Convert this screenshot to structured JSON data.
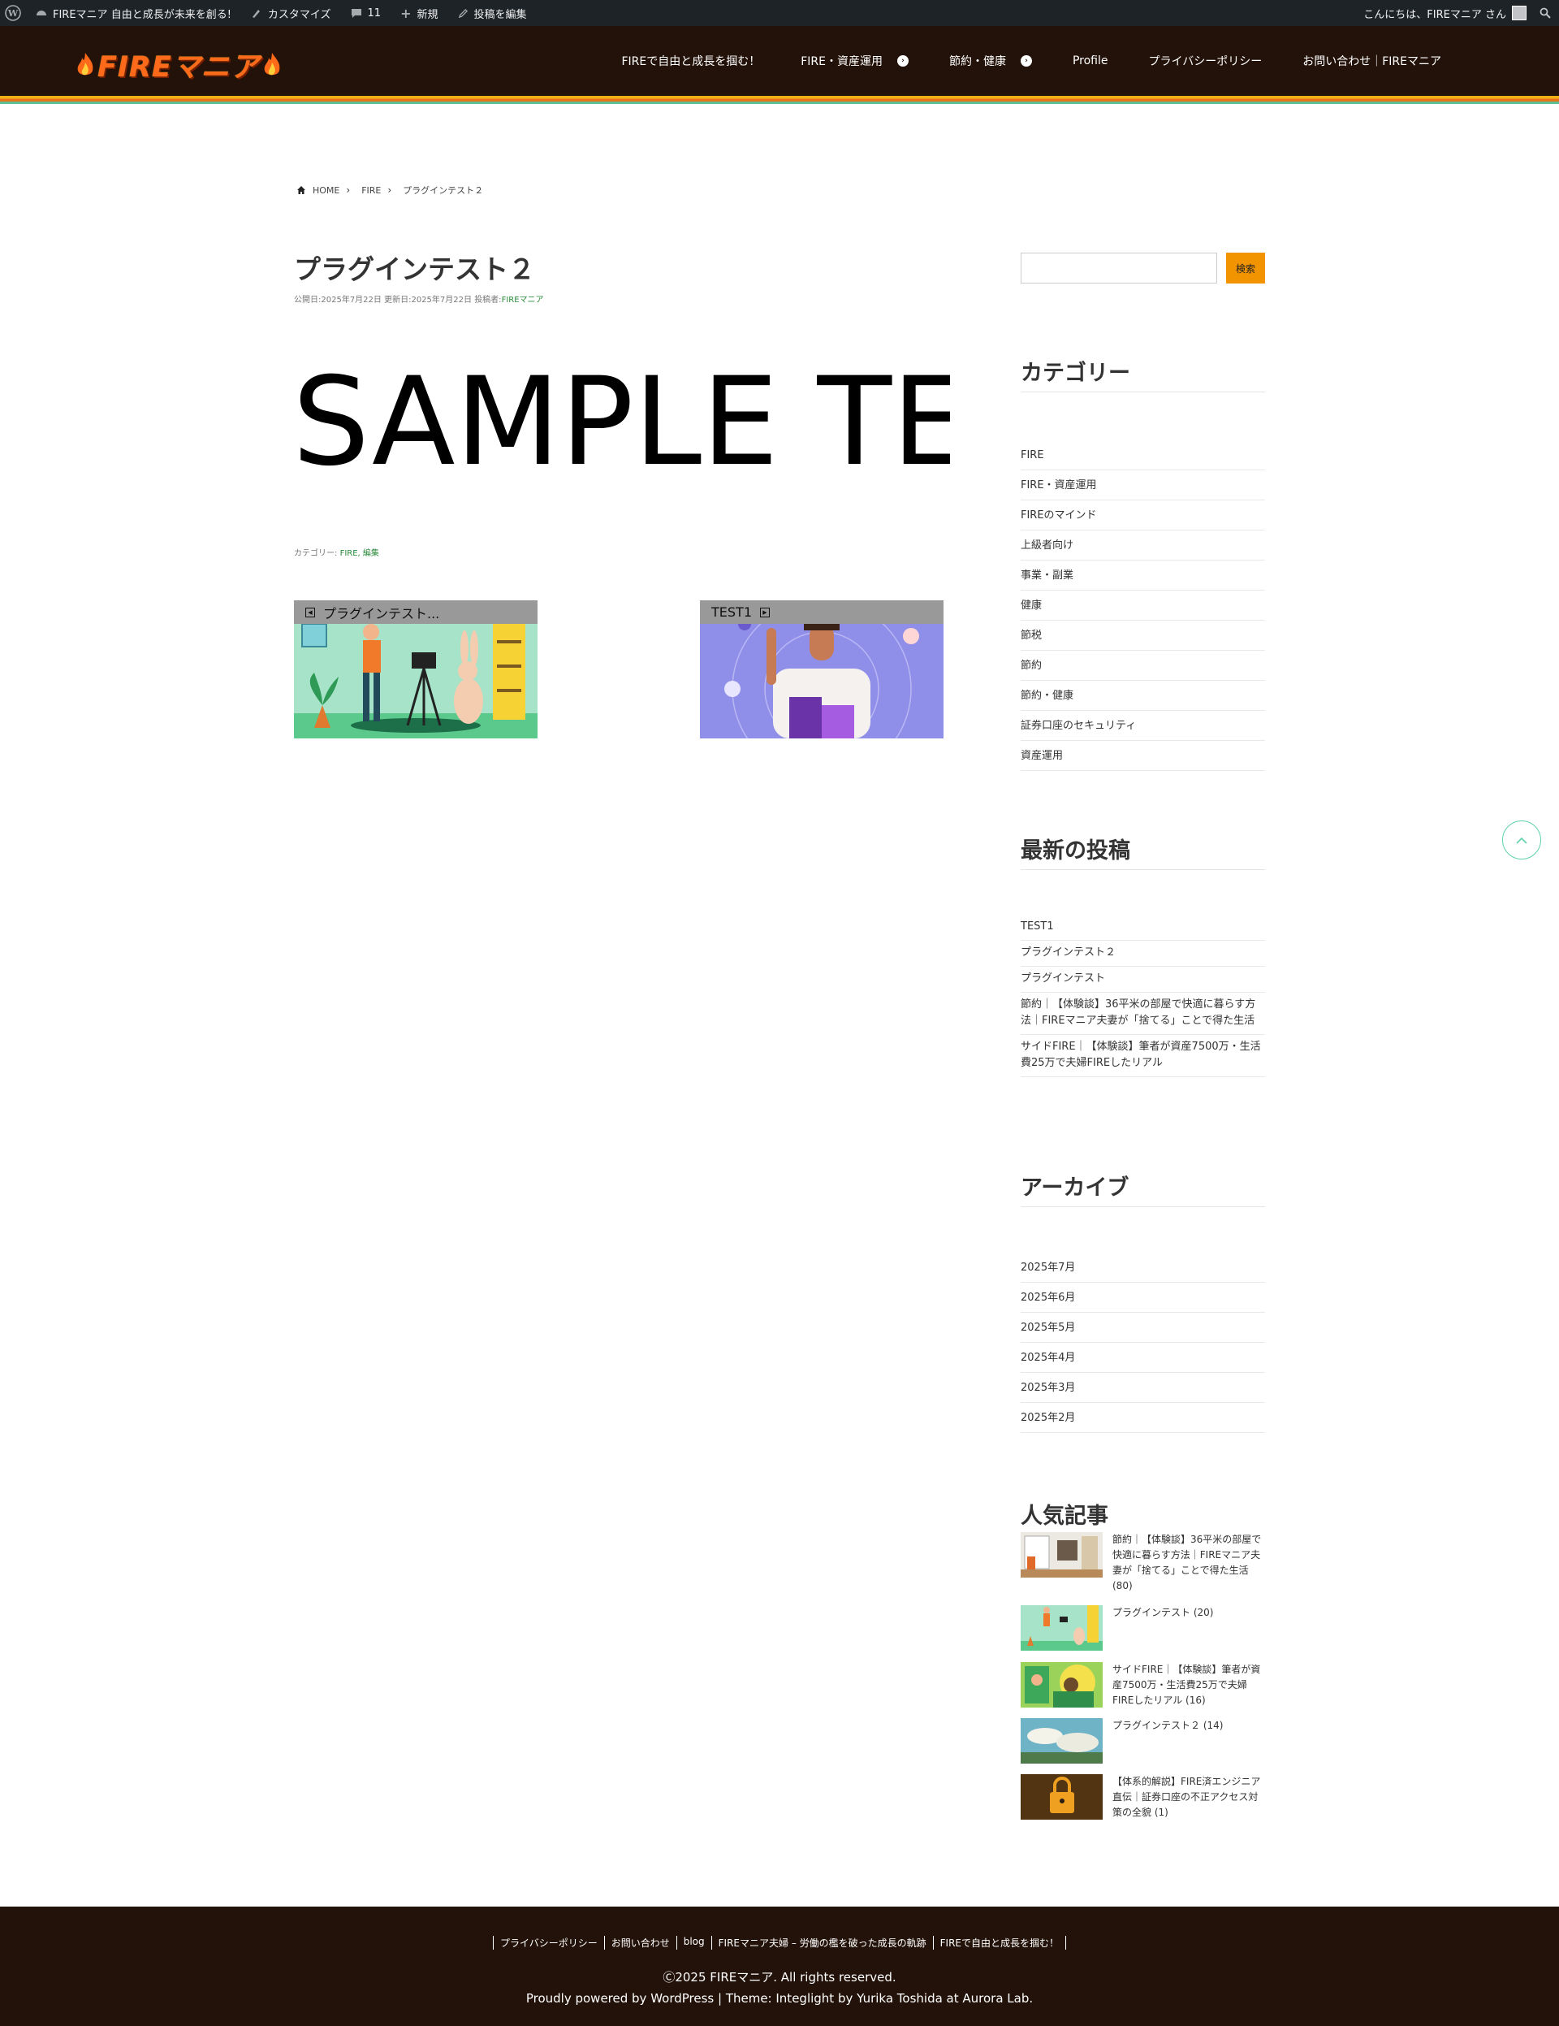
{
  "admin_bar": {
    "site_name": "FIREマニア 自由と成長が未来を創る!",
    "customize": "カスタマイズ",
    "comments_count": "11",
    "new": "新規",
    "edit_post": "投稿を編集",
    "greeting": "こんにちは、FIREマニア さん"
  },
  "header": {
    "logo_text": "FIREマニア",
    "nav": [
      {
        "label": "FIREで自由と成長を掴む！",
        "has_sub": false
      },
      {
        "label": "FIRE・資産運用",
        "has_sub": true
      },
      {
        "label": "節約・健康",
        "has_sub": true
      },
      {
        "label": "Profile",
        "has_sub": false
      },
      {
        "label": "プライバシーポリシー",
        "has_sub": false
      },
      {
        "label": "お問い合わせ｜FIREマニア",
        "has_sub": false
      }
    ]
  },
  "breadcrumb": [
    "HOME",
    "FIRE",
    "プラグインテスト２"
  ],
  "post": {
    "title": "プラグインテスト２",
    "meta_published": "公開日:2025年7月22日",
    "meta_updated": "更新日:2025年7月22日",
    "meta_author_label": "投稿者:",
    "meta_author": "FIREマニア",
    "body_text": "SAMPLE TE",
    "categories_label": "カテゴリー:",
    "categories": "FIRE, 編集",
    "prev_post": "プラグインテスト...",
    "next_post": "TEST1"
  },
  "sidebar": {
    "search_button": "検索",
    "categories_title": "カテゴリー",
    "categories": [
      "FIRE",
      "FIRE・資産運用",
      "FIREのマインド",
      "上級者向け",
      "事業・副業",
      "健康",
      "節税",
      "節約",
      "節約・健康",
      "証券口座のセキュリティ",
      "資産運用"
    ],
    "recent_title": "最新の投稿",
    "recent": [
      "TEST1",
      "プラグインテスト２",
      "プラグインテスト",
      "節約｜【体験談】36平米の部屋で快適に暮らす方法｜FIREマニア夫妻が「捨てる」ことで得た生活",
      "サイドFIRE｜【体験談】筆者が資産7500万・生活費25万で夫婦FIREしたリアル"
    ],
    "archive_title": "アーカイブ",
    "archives": [
      "2025年7月",
      "2025年6月",
      "2025年5月",
      "2025年4月",
      "2025年3月",
      "2025年2月"
    ],
    "popular_title": "人気記事",
    "popular": [
      "節約｜【体験談】36平米の部屋で快適に暮らす方法｜FIREマニア夫妻が「捨てる」ことで得た生活 (80)",
      "プラグインテスト (20)",
      "サイドFIRE｜【体験談】筆者が資産7500万・生活費25万で夫婦FIREしたリアル (16)",
      "プラグインテスト２ (14)",
      "【体系的解説】FIRE済エンジニア直伝｜証券口座の不正アクセス対策の全貌 (1)"
    ]
  },
  "footer": {
    "links": [
      "プライバシーポリシー",
      "お問い合わせ",
      "blog",
      "FIREマニア夫婦 – 労働の檻を破った成長の軌跡",
      "FIREで自由と成長を掴む！"
    ],
    "copyright": "Ⓒ2025 FIREマニア. All rights reserved.",
    "powered": "Proudly powered by WordPress | Theme: Integlight by Yurika Toshida at Aurora Lab."
  },
  "colors": {
    "admin_bar": "#1d2327",
    "header_bg": "#231209",
    "accent_orange": "#f29300",
    "link_green": "#2a8a3a",
    "back_to_top": "#5fd1ab"
  }
}
